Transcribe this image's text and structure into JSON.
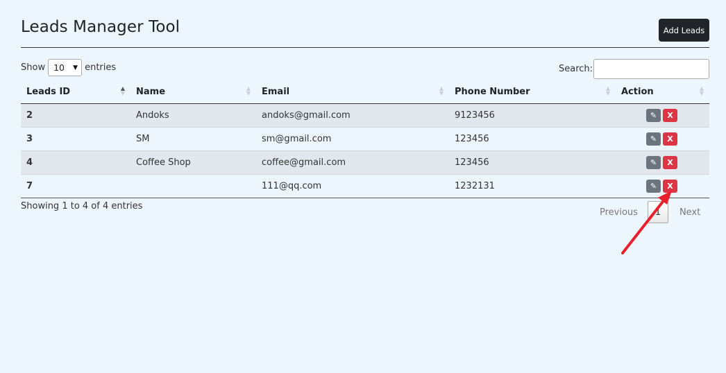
{
  "header": {
    "title": "Leads Manager Tool",
    "add_button": "Add Leads"
  },
  "length": {
    "prefix": "Show",
    "value": "10",
    "suffix": "entries"
  },
  "search": {
    "label": "Search:",
    "value": ""
  },
  "table": {
    "columns": [
      "Leads ID",
      "Name",
      "Email",
      "Phone Number",
      "Action"
    ],
    "rows": [
      {
        "id": "2",
        "name": "Andoks",
        "email": "andoks@gmail.com",
        "phone": "9123456",
        "edit_icon": "pencil-icon",
        "delete_label": "X"
      },
      {
        "id": "3",
        "name": "SM",
        "email": "sm@gmail.com",
        "phone": "123456",
        "edit_icon": "pencil-icon",
        "delete_label": "X"
      },
      {
        "id": "4",
        "name": "Coffee Shop",
        "email": "coffee@gmail.com",
        "phone": "123456",
        "edit_icon": "pencil-icon",
        "delete_label": "X"
      },
      {
        "id": "7",
        "name": "",
        "email": "111@qq.com",
        "phone": "1232131",
        "edit_icon": "pencil-icon",
        "delete_label": "X"
      }
    ]
  },
  "footer": {
    "info": "Showing 1 to 4 of 4 entries",
    "previous": "Previous",
    "current_page": "1",
    "next": "Next"
  },
  "colors": {
    "delete": "#dc3545",
    "edit": "#6c757d",
    "annotation_arrow": "#e8202a",
    "dark_button": "#212529"
  }
}
